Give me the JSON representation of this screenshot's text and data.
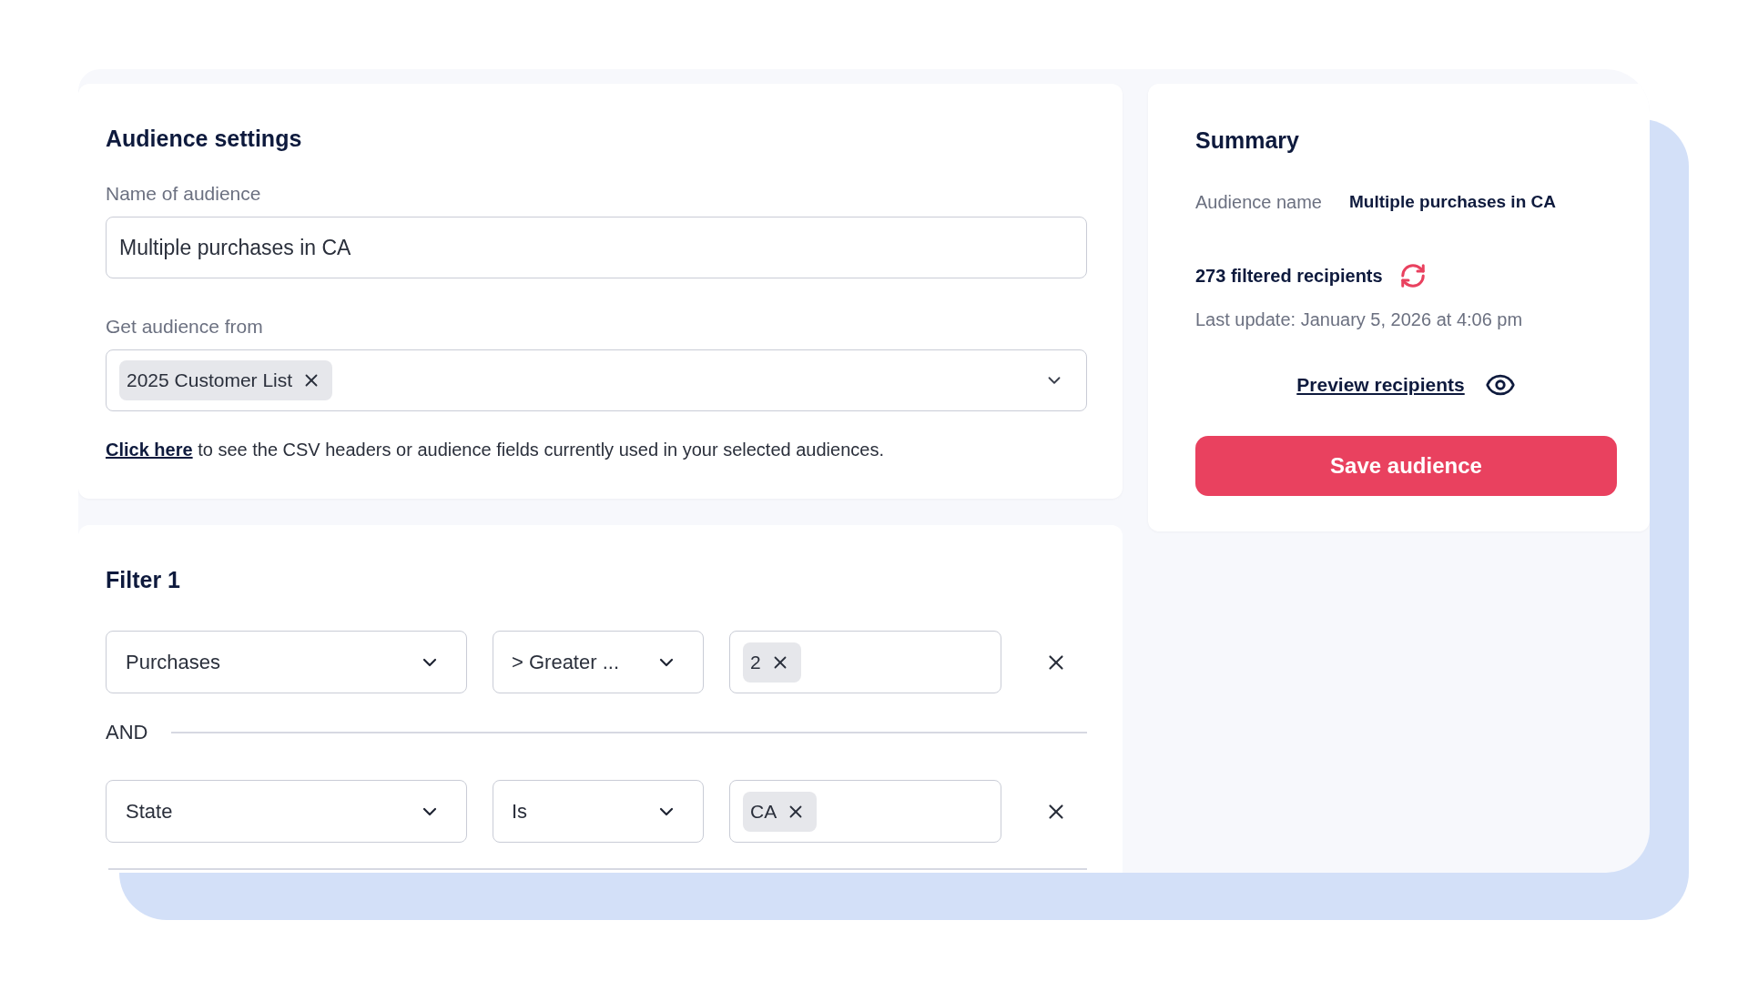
{
  "audience_settings": {
    "title": "Audience settings",
    "name_field": {
      "label": "Name of audience",
      "value": "Multiple purchases in CA"
    },
    "source_field": {
      "label": "Get audience from",
      "tags": [
        "2025 Customer List"
      ]
    },
    "help_text": {
      "link": "Click here",
      "rest": "to see the CSV headers or audience fields currently used in your selected audiences."
    }
  },
  "filter": {
    "title": "Filter 1",
    "items": [
      {
        "kind": "condition",
        "field": "Purchases",
        "operator": "> Greater ...",
        "values": [
          "2"
        ]
      },
      {
        "kind": "connector",
        "label": "AND"
      },
      {
        "kind": "condition",
        "field": "State",
        "operator": "Is",
        "values": [
          "CA"
        ]
      }
    ]
  },
  "summary": {
    "title": "Summary",
    "audience_name": {
      "label": "Audience name",
      "value": "Multiple purchases in CA"
    },
    "recipients": "273 filtered recipients",
    "last_update": "Last update: January 5, 2026 at 4:06 pm",
    "preview_link": "Preview recipients",
    "save_button": "Save audience"
  }
}
